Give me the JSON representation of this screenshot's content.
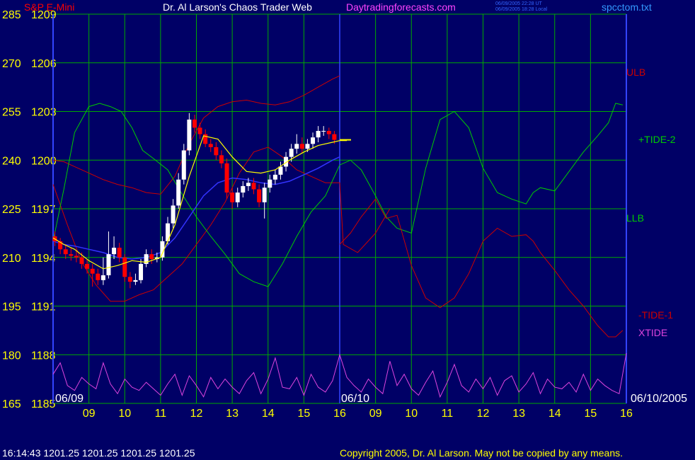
{
  "header": {
    "instrument": "S&P E-Mini",
    "title": "Dr. Al Larson's Chaos Trader Web",
    "site": "Daytradingforecasts.com",
    "utc_stamp": "06/09/2005 22:28 UT",
    "local_stamp": "06/09/2005 18:28 Local",
    "filename": "spcctom.txt"
  },
  "footer": {
    "quote": "16:14:43  1201.25 1201.25 1201.25 1201.25",
    "copyright": "Copyright 2005, Dr. Al Larson. May not be copied by any means."
  },
  "colors": {
    "background": "#000066",
    "grid": "#00aa00",
    "axis_text": "#ffff00",
    "price_up": "#ffffff",
    "price_down": "#ff0000",
    "ulb_llb": "#cc0000",
    "tide_pos": "#00cc00",
    "tide_neg": "#cc0000",
    "xtide": "#dd44dd",
    "moving_avg": "#3333ff",
    "header_title": "#ffffff",
    "site": "#ff44ff",
    "filename": "#3399ff"
  },
  "chart_data": {
    "type": "line",
    "title": "Dr. Al Larson's Chaos Trader Web",
    "y_left_ticks": [
      285,
      270,
      255,
      240,
      225,
      210,
      195,
      180,
      165
    ],
    "y_price_ticks": [
      1209,
      1206,
      1203,
      1200,
      1197,
      1194,
      1191,
      1188,
      1185
    ],
    "ylim_price": [
      1185,
      1209
    ],
    "x_hours_ticks": [
      9,
      10,
      11,
      12,
      13,
      14,
      15,
      16,
      9,
      10,
      11,
      12,
      13,
      14,
      15,
      16
    ],
    "x_tick_labels": [
      "09",
      "10",
      "11",
      "12",
      "13",
      "14",
      "15",
      "16",
      "09",
      "10",
      "11",
      "12",
      "13",
      "14",
      "15",
      "16"
    ],
    "date_labels": [
      "06/09",
      "06/10",
      "06/10/2005"
    ],
    "last_price": 1201.25,
    "series_labels": {
      "ulb": "ULB",
      "llb": "LLB",
      "tide_pos": "+TIDE-2",
      "tide_neg": "-TIDE-1",
      "xtide": "XTIDE"
    },
    "session_boundary_x": 16,
    "series": {
      "ulb": {
        "x": [
          8.0,
          8.3,
          8.6,
          9.0,
          9.4,
          9.8,
          10.2,
          10.6,
          11.0,
          11.4,
          11.8,
          12.2,
          12.6,
          13.0,
          13.4,
          13.8,
          14.2,
          14.6,
          15.0,
          15.4,
          15.8,
          16.0
        ],
        "y": [
          1200.0,
          1199.9,
          1199.6,
          1199.2,
          1198.8,
          1198.5,
          1198.3,
          1198.0,
          1197.9,
          1199.0,
          1201.0,
          1202.6,
          1203.3,
          1203.6,
          1203.7,
          1203.5,
          1203.4,
          1203.6,
          1204.0,
          1204.5,
          1205.0,
          1205.2
        ]
      },
      "llb": {
        "x": [
          8.0,
          8.4,
          8.8,
          9.2,
          9.6,
          10.0,
          10.4,
          10.8,
          11.2,
          11.6,
          12.0,
          12.4,
          12.8,
          13.2,
          13.6,
          14.0,
          14.4,
          14.8,
          15.2,
          15.6,
          16.0,
          16.1,
          16.5,
          17.0,
          17.4
        ],
        "y": [
          1198.5,
          1196.0,
          1193.7,
          1192.3,
          1191.3,
          1191.3,
          1191.7,
          1192.0,
          1192.8,
          1193.6,
          1194.8,
          1196.0,
          1197.4,
          1199.2,
          1200.5,
          1200.8,
          1200.2,
          1199.4,
          1199.0,
          1198.6,
          1198.6,
          1194.8,
          1194.3,
          1195.5,
          1197.0
        ]
      },
      "tide_pos": {
        "x": [
          8.0,
          8.3,
          8.6,
          9.0,
          9.3,
          9.6,
          9.9,
          10.2,
          10.5,
          10.8,
          11.2,
          11.6,
          12.0,
          12.4,
          12.8,
          13.2,
          13.6,
          14.0,
          14.4,
          14.8,
          15.2,
          15.6,
          16.0,
          16.3,
          16.6,
          17.0,
          17.3,
          17.6,
          18.0,
          18.4,
          18.8,
          19.2,
          19.6,
          20.0,
          20.4,
          20.8,
          21.2,
          21.4,
          21.6,
          22.0,
          22.4,
          22.8,
          23.2,
          23.5,
          23.7,
          23.9
        ],
        "y": [
          1195.0,
          1198.2,
          1201.7,
          1203.3,
          1203.5,
          1203.3,
          1203.0,
          1202.0,
          1200.6,
          1200.1,
          1199.4,
          1197.9,
          1196.5,
          1195.3,
          1194.2,
          1193.0,
          1192.5,
          1192.2,
          1193.6,
          1195.3,
          1196.8,
          1197.8,
          1199.7,
          1200.0,
          1199.4,
          1197.8,
          1196.5,
          1195.8,
          1195.5,
          1199.5,
          1202.5,
          1203.0,
          1202.0,
          1199.5,
          1198.0,
          1197.6,
          1197.3,
          1198.0,
          1198.3,
          1198.1,
          1199.3,
          1200.5,
          1201.5,
          1202.3,
          1203.5,
          1203.4
        ]
      },
      "tide_neg": {
        "x": [
          16.0,
          16.3,
          16.6,
          17.0,
          17.3,
          17.6,
          18.0,
          18.4,
          18.8,
          19.2,
          19.6,
          20.0,
          20.4,
          20.8,
          21.2,
          21.4,
          21.6,
          22.0,
          22.4,
          22.8,
          23.2,
          23.5,
          23.7,
          23.9
        ],
        "y": [
          1194.8,
          1195.5,
          1196.5,
          1197.6,
          1196.4,
          1196.6,
          1193.5,
          1191.5,
          1190.9,
          1191.5,
          1193.0,
          1195.0,
          1195.8,
          1195.3,
          1195.4,
          1195.0,
          1194.3,
          1193.2,
          1192.0,
          1191.0,
          1189.8,
          1189.1,
          1189.1,
          1189.5
        ]
      },
      "moving_avg": {
        "x": [
          8.0,
          8.3,
          8.6,
          9.0,
          9.4,
          9.8,
          10.2,
          10.6,
          11.0,
          11.4,
          11.8,
          12.2,
          12.6,
          13.0,
          13.4,
          13.8,
          14.2,
          14.6,
          15.0,
          15.4,
          15.8,
          16.0
        ],
        "y": [
          1195.0,
          1194.8,
          1194.7,
          1194.5,
          1194.3,
          1194.0,
          1193.9,
          1194.0,
          1194.3,
          1195.2,
          1196.5,
          1197.8,
          1198.6,
          1198.9,
          1198.8,
          1198.6,
          1198.5,
          1198.7,
          1199.1,
          1199.5,
          1200.0,
          1200.2
        ]
      },
      "price_trend": {
        "x": [
          8.0,
          8.3,
          8.6,
          9.0,
          9.4,
          9.8,
          10.2,
          10.6,
          11.0,
          11.4,
          11.8,
          12.2,
          12.6,
          13.0,
          13.4,
          13.8,
          14.2,
          14.6,
          15.0,
          15.4,
          15.8,
          16.0,
          16.2
        ],
        "y": [
          1195.2,
          1194.8,
          1194.5,
          1193.8,
          1193.3,
          1193.5,
          1193.8,
          1193.7,
          1194.0,
          1196.0,
          1199.0,
          1201.5,
          1201.3,
          1200.2,
          1199.3,
          1199.2,
          1199.4,
          1200.0,
          1200.5,
          1200.9,
          1201.1,
          1201.2,
          1201.2
        ]
      },
      "price_bars": {
        "x": [
          8.05,
          8.2,
          8.35,
          8.5,
          8.65,
          8.8,
          8.95,
          9.1,
          9.25,
          9.4,
          9.55,
          9.7,
          9.85,
          10.0,
          10.15,
          10.3,
          10.45,
          10.6,
          10.75,
          10.9,
          11.05,
          11.2,
          11.35,
          11.5,
          11.65,
          11.8,
          11.95,
          12.1,
          12.25,
          12.4,
          12.55,
          12.7,
          12.85,
          13.0,
          13.15,
          13.3,
          13.45,
          13.6,
          13.75,
          13.9,
          14.05,
          14.2,
          14.35,
          14.5,
          14.65,
          14.8,
          14.95,
          15.1,
          15.25,
          15.4,
          15.55,
          15.7,
          15.85
        ],
        "open": [
          1195.3,
          1195.0,
          1194.5,
          1194.2,
          1194.1,
          1194.0,
          1193.6,
          1193.3,
          1193.0,
          1192.6,
          1192.9,
          1194.2,
          1194.6,
          1194.0,
          1192.8,
          1192.5,
          1192.6,
          1193.6,
          1194.2,
          1193.9,
          1194.0,
          1195.0,
          1196.1,
          1197.2,
          1198.8,
          1200.6,
          1202.5,
          1202.0,
          1201.6,
          1201.0,
          1200.8,
          1200.3,
          1199.8,
          1198.0,
          1197.4,
          1198.0,
          1198.4,
          1198.6,
          1198.2,
          1197.4,
          1198.3,
          1198.8,
          1199.1,
          1199.6,
          1200.2,
          1200.7,
          1201.0,
          1200.7,
          1201.0,
          1201.4,
          1201.8,
          1201.8,
          1201.6
        ],
        "close": [
          1195.0,
          1194.5,
          1194.2,
          1194.1,
          1194.0,
          1193.6,
          1193.3,
          1193.0,
          1192.6,
          1192.9,
          1194.2,
          1194.6,
          1194.0,
          1192.8,
          1192.5,
          1192.6,
          1193.6,
          1194.2,
          1193.9,
          1194.0,
          1195.0,
          1196.1,
          1197.2,
          1198.8,
          1200.6,
          1202.5,
          1202.0,
          1201.6,
          1201.0,
          1200.8,
          1200.3,
          1199.8,
          1198.0,
          1197.4,
          1198.0,
          1198.4,
          1198.6,
          1198.2,
          1197.4,
          1198.3,
          1198.8,
          1199.1,
          1199.6,
          1200.2,
          1200.7,
          1201.0,
          1200.7,
          1201.0,
          1201.4,
          1201.8,
          1201.8,
          1201.6,
          1201.25
        ],
        "high": [
          1195.6,
          1195.2,
          1194.8,
          1194.6,
          1194.4,
          1194.3,
          1193.9,
          1193.6,
          1193.3,
          1194.0,
          1195.6,
          1195.3,
          1194.9,
          1194.2,
          1193.1,
          1193.0,
          1193.9,
          1194.5,
          1194.5,
          1194.3,
          1195.3,
          1196.5,
          1197.6,
          1199.2,
          1201.0,
          1202.9,
          1202.8,
          1202.3,
          1201.9,
          1201.3,
          1201.1,
          1200.6,
          1200.1,
          1198.3,
          1198.3,
          1198.7,
          1198.9,
          1198.9,
          1198.5,
          1198.6,
          1199.1,
          1199.4,
          1199.9,
          1200.5,
          1201.0,
          1201.6,
          1201.4,
          1201.3,
          1201.7,
          1202.1,
          1202.1,
          1202.0,
          1201.8
        ],
        "low": [
          1194.7,
          1194.2,
          1193.9,
          1193.8,
          1193.7,
          1193.3,
          1193.0,
          1192.2,
          1192.3,
          1192.3,
          1192.7,
          1193.9,
          1193.7,
          1192.5,
          1192.1,
          1192.3,
          1192.4,
          1193.4,
          1193.6,
          1193.7,
          1193.8,
          1194.8,
          1195.8,
          1197.0,
          1198.5,
          1200.3,
          1201.7,
          1201.3,
          1200.8,
          1200.5,
          1200.0,
          1199.5,
          1197.6,
          1197.0,
          1197.1,
          1197.7,
          1198.1,
          1197.9,
          1197.1,
          1196.4,
          1198.0,
          1198.5,
          1198.8,
          1199.3,
          1199.9,
          1200.4,
          1200.4,
          1200.5,
          1200.7,
          1201.1,
          1201.5,
          1201.3,
          1201.0
        ]
      },
      "xtide": {
        "x": [
          8.0,
          8.2,
          8.4,
          8.6,
          8.8,
          9.0,
          9.2,
          9.4,
          9.6,
          9.8,
          10.0,
          10.2,
          10.4,
          10.6,
          10.8,
          11.0,
          11.2,
          11.4,
          11.6,
          11.8,
          12.0,
          12.2,
          12.4,
          12.6,
          12.8,
          13.0,
          13.2,
          13.4,
          13.6,
          13.8,
          14.0,
          14.2,
          14.4,
          14.6,
          14.8,
          15.0,
          15.2,
          15.4,
          15.6,
          15.8,
          16.0,
          16.2,
          16.4,
          16.6,
          16.8,
          17.0,
          17.2,
          17.4,
          17.6,
          17.8,
          18.0,
          18.2,
          18.4,
          18.6,
          18.8,
          19.0,
          19.2,
          19.4,
          19.6,
          19.8,
          20.0,
          20.2,
          20.4,
          20.6,
          20.8,
          21.0,
          21.2,
          21.4,
          21.6,
          21.8,
          22.0,
          22.2,
          22.4,
          22.6,
          22.8,
          23.0,
          23.2,
          23.4,
          23.6,
          23.8,
          24.0
        ],
        "y": [
          1186.8,
          1187.5,
          1186.1,
          1185.8,
          1186.6,
          1186.2,
          1185.9,
          1187.5,
          1186.2,
          1185.6,
          1186.5,
          1186.0,
          1185.8,
          1186.3,
          1185.9,
          1185.5,
          1186.2,
          1186.8,
          1185.5,
          1186.7,
          1186.1,
          1185.4,
          1186.6,
          1185.9,
          1186.5,
          1186.0,
          1185.6,
          1186.4,
          1186.9,
          1185.6,
          1186.5,
          1187.8,
          1186.0,
          1185.9,
          1186.6,
          1185.5,
          1186.8,
          1186.0,
          1185.7,
          1186.4,
          1188.0,
          1186.6,
          1186.1,
          1185.7,
          1186.5,
          1186.0,
          1185.6,
          1187.6,
          1186.1,
          1186.8,
          1185.9,
          1185.5,
          1186.3,
          1187.0,
          1185.4,
          1186.3,
          1187.4,
          1186.1,
          1185.7,
          1186.5,
          1185.9,
          1186.6,
          1185.5,
          1186.4,
          1186.7,
          1185.7,
          1186.2,
          1186.9,
          1185.6,
          1186.5,
          1186.0,
          1185.9,
          1186.3,
          1185.7,
          1186.8,
          1185.8,
          1186.5,
          1186.1,
          1185.8,
          1185.6,
          1188.1
        ]
      }
    }
  }
}
